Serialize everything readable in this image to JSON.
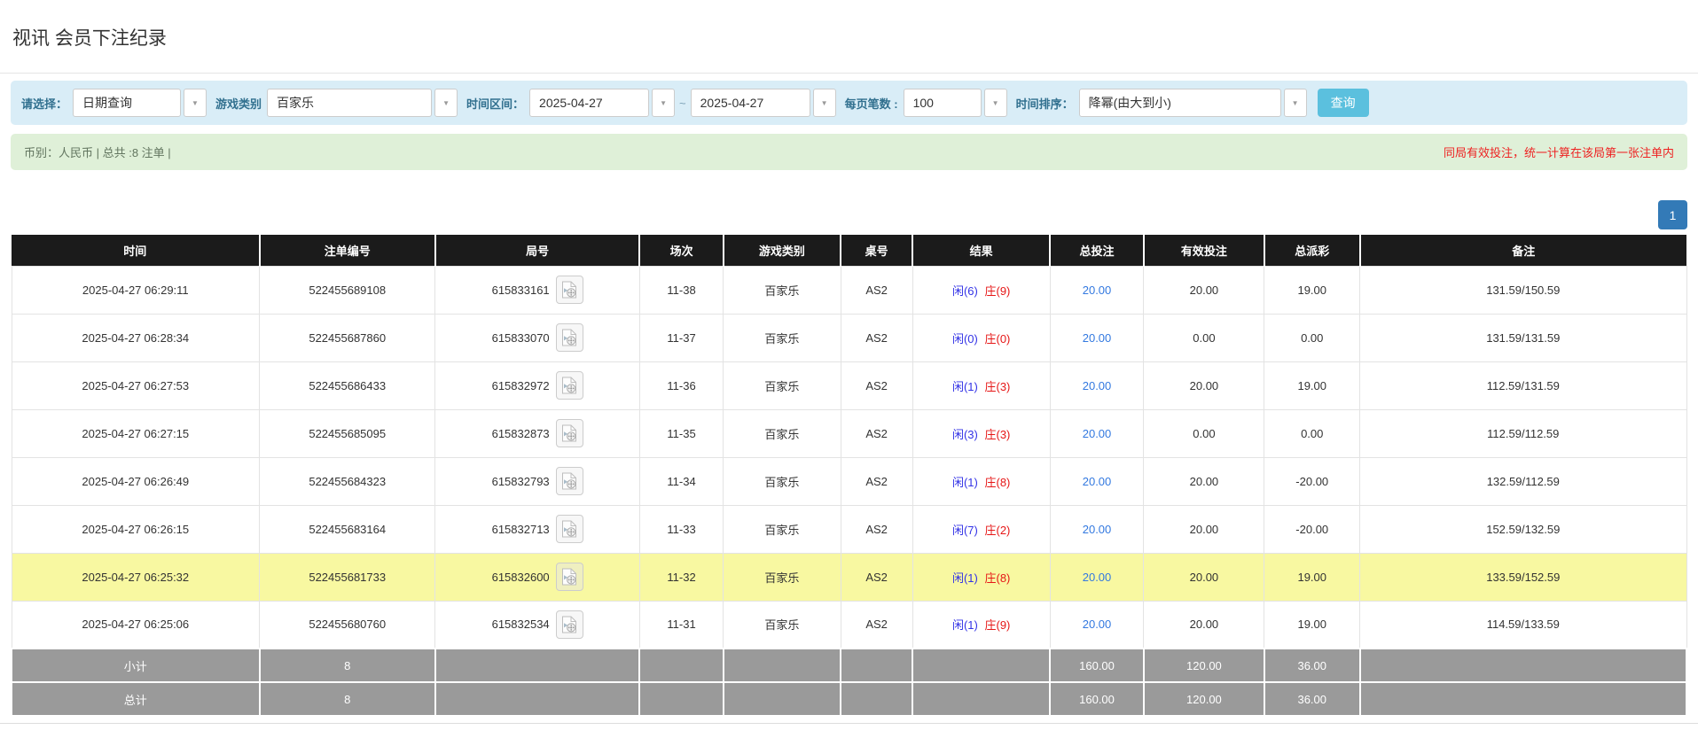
{
  "page": {
    "title": "视讯 会员下注纪录"
  },
  "filters": {
    "query_type_label": "请选择：",
    "query_type_value": "日期查询",
    "game_category_label": "游戏类别",
    "game_category_value": "百家乐",
    "time_range_label": "时间区间：",
    "date_from": "2025-04-27",
    "tilde": "~",
    "date_to": "2025-04-27",
    "per_page_label": "每页笔数 :",
    "per_page_value": "100",
    "sort_label": "时间排序：",
    "sort_value": "降幂(由大到小)",
    "search_button_label": "查询"
  },
  "summary": {
    "left_text": "币别：人民币 | 总共 :8 注单 |",
    "right_notice": "同局有效投注，统一计算在该局第一张注单内"
  },
  "pagination": {
    "current_page": "1"
  },
  "colors": {
    "accent_blue": "#5bc0de",
    "pagination_blue": "#337ab7",
    "link_blue": "#3379e0",
    "player_blue": "#3333e6",
    "banker_red": "#e61717",
    "negative_red": "#e60000",
    "notice_red": "#ee2222",
    "highlight_yellow": "#f8f8a1",
    "filter_bg": "#d9edf7",
    "summary_bg": "#dff0d8",
    "header_bg": "#1b1b1b",
    "footer_bg": "#9a9a9a"
  },
  "table": {
    "headers": [
      "时间",
      "注单编号",
      "局号",
      "场次",
      "游戏类别",
      "桌号",
      "结果",
      "总投注",
      "有效投注",
      "总派彩",
      "备注"
    ],
    "rows": [
      {
        "time": "2025-04-27 06:29:11",
        "bet_id": "522455689108",
        "round_id": "615833161",
        "session": "11-38",
        "game": "百家乐",
        "table_no": "AS2",
        "result_player": "闲(6)",
        "result_banker": "庄(9)",
        "total_bet": "20.00",
        "valid_bet": "20.00",
        "payout": "19.00",
        "remark": "131.59/150.59",
        "highlight": false
      },
      {
        "time": "2025-04-27 06:28:34",
        "bet_id": "522455687860",
        "round_id": "615833070",
        "session": "11-37",
        "game": "百家乐",
        "table_no": "AS2",
        "result_player": "闲(0)",
        "result_banker": "庄(0)",
        "total_bet": "20.00",
        "valid_bet": "0.00",
        "payout": "0.00",
        "remark": "131.59/131.59",
        "highlight": false
      },
      {
        "time": "2025-04-27 06:27:53",
        "bet_id": "522455686433",
        "round_id": "615832972",
        "session": "11-36",
        "game": "百家乐",
        "table_no": "AS2",
        "result_player": "闲(1)",
        "result_banker": "庄(3)",
        "total_bet": "20.00",
        "valid_bet": "20.00",
        "payout": "19.00",
        "remark": "112.59/131.59",
        "highlight": false
      },
      {
        "time": "2025-04-27 06:27:15",
        "bet_id": "522455685095",
        "round_id": "615832873",
        "session": "11-35",
        "game": "百家乐",
        "table_no": "AS2",
        "result_player": "闲(3)",
        "result_banker": "庄(3)",
        "total_bet": "20.00",
        "valid_bet": "0.00",
        "payout": "0.00",
        "remark": "112.59/112.59",
        "highlight": false
      },
      {
        "time": "2025-04-27 06:26:49",
        "bet_id": "522455684323",
        "round_id": "615832793",
        "session": "11-34",
        "game": "百家乐",
        "table_no": "AS2",
        "result_player": "闲(1)",
        "result_banker": "庄(8)",
        "total_bet": "20.00",
        "valid_bet": "20.00",
        "payout": "-20.00",
        "remark": "132.59/112.59",
        "highlight": false
      },
      {
        "time": "2025-04-27 06:26:15",
        "bet_id": "522455683164",
        "round_id": "615832713",
        "session": "11-33",
        "game": "百家乐",
        "table_no": "AS2",
        "result_player": "闲(7)",
        "result_banker": "庄(2)",
        "total_bet": "20.00",
        "valid_bet": "20.00",
        "payout": "-20.00",
        "remark": "152.59/132.59",
        "highlight": false
      },
      {
        "time": "2025-04-27 06:25:32",
        "bet_id": "522455681733",
        "round_id": "615832600",
        "session": "11-32",
        "game": "百家乐",
        "table_no": "AS2",
        "result_player": "闲(1)",
        "result_banker": "庄(8)",
        "total_bet": "20.00",
        "valid_bet": "20.00",
        "payout": "19.00",
        "remark": "133.59/152.59",
        "highlight": true
      },
      {
        "time": "2025-04-27 06:25:06",
        "bet_id": "522455680760",
        "round_id": "615832534",
        "session": "11-31",
        "game": "百家乐",
        "table_no": "AS2",
        "result_player": "闲(1)",
        "result_banker": "庄(9)",
        "total_bet": "20.00",
        "valid_bet": "20.00",
        "payout": "19.00",
        "remark": "114.59/133.59",
        "highlight": false
      }
    ],
    "footer": [
      {
        "key": "subtotal",
        "label": "小计",
        "count": "8",
        "total_bet": "160.00",
        "valid_bet": "120.00",
        "payout": "36.00"
      },
      {
        "key": "total",
        "label": "总计",
        "count": "8",
        "total_bet": "160.00",
        "valid_bet": "120.00",
        "payout": "36.00"
      }
    ]
  }
}
